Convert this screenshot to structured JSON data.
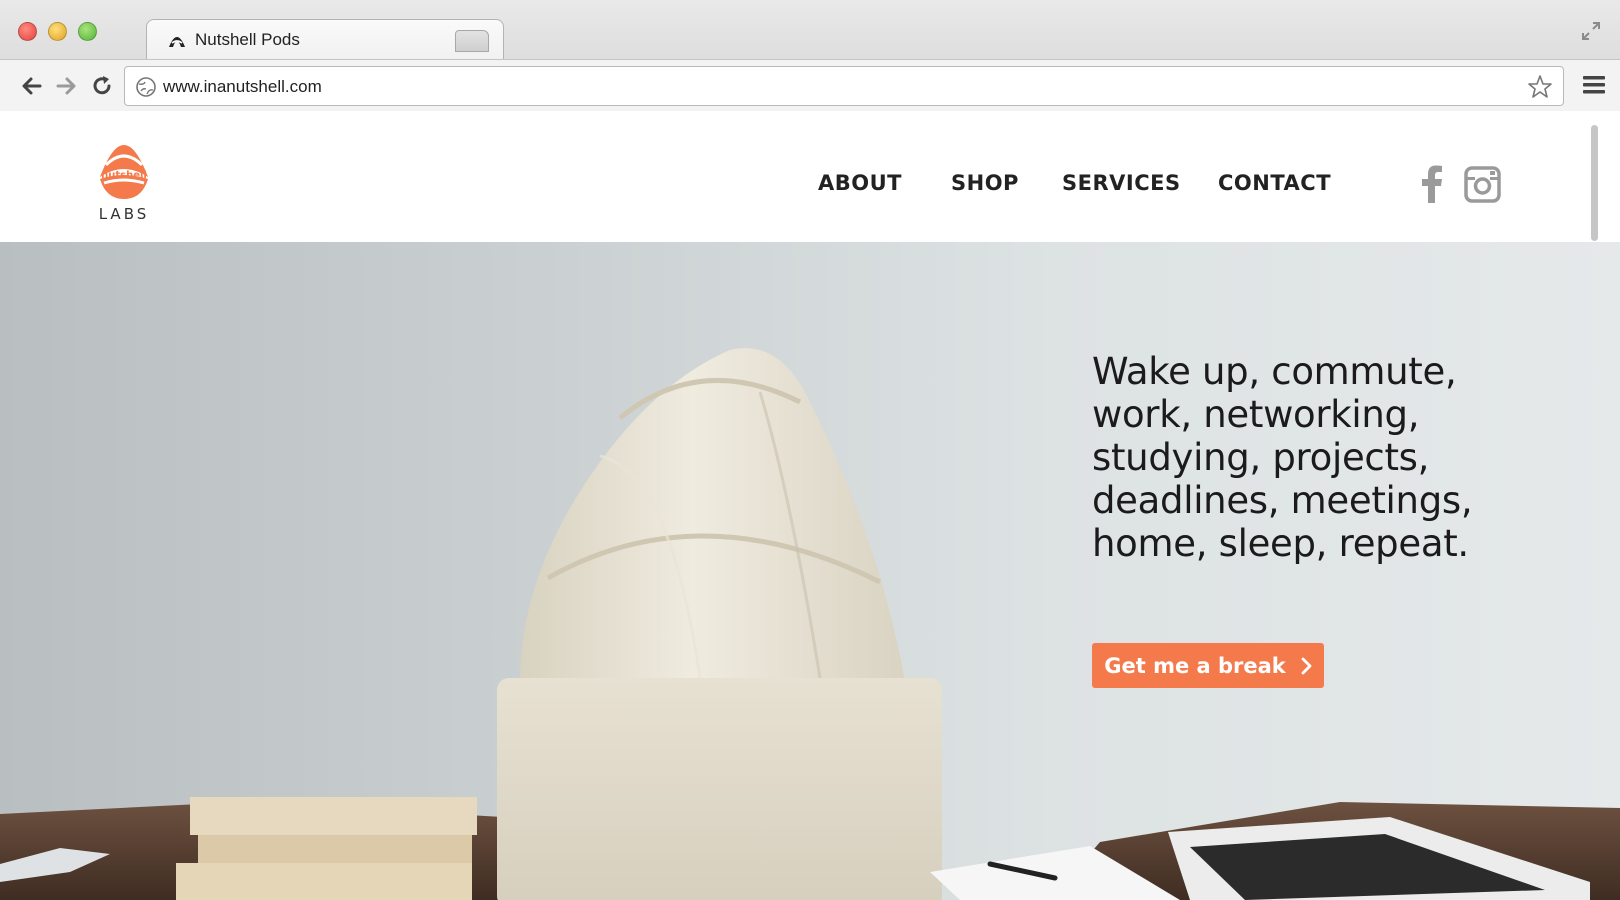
{
  "browser": {
    "tab_title": "Nutshell Pods",
    "tab_close": "×",
    "url": "www.inanutshell.com"
  },
  "site": {
    "logo_wordmark": "nutshell",
    "logo_sub": "LABS",
    "nav": [
      {
        "label": "ABOUT"
      },
      {
        "label": "SHOP"
      },
      {
        "label": "SERVICES"
      },
      {
        "label": "CONTACT"
      }
    ],
    "social": [
      "facebook-icon",
      "instagram-icon"
    ]
  },
  "hero": {
    "headline_lines": [
      "Wake up, commute,",
      "work, networking,",
      "studying, projects,",
      "deadlines, meetings,",
      "home, sleep, repeat."
    ],
    "cta_label": "Get me a break"
  },
  "colors": {
    "accent": "#f47a4b",
    "text": "#1b1b1b"
  }
}
